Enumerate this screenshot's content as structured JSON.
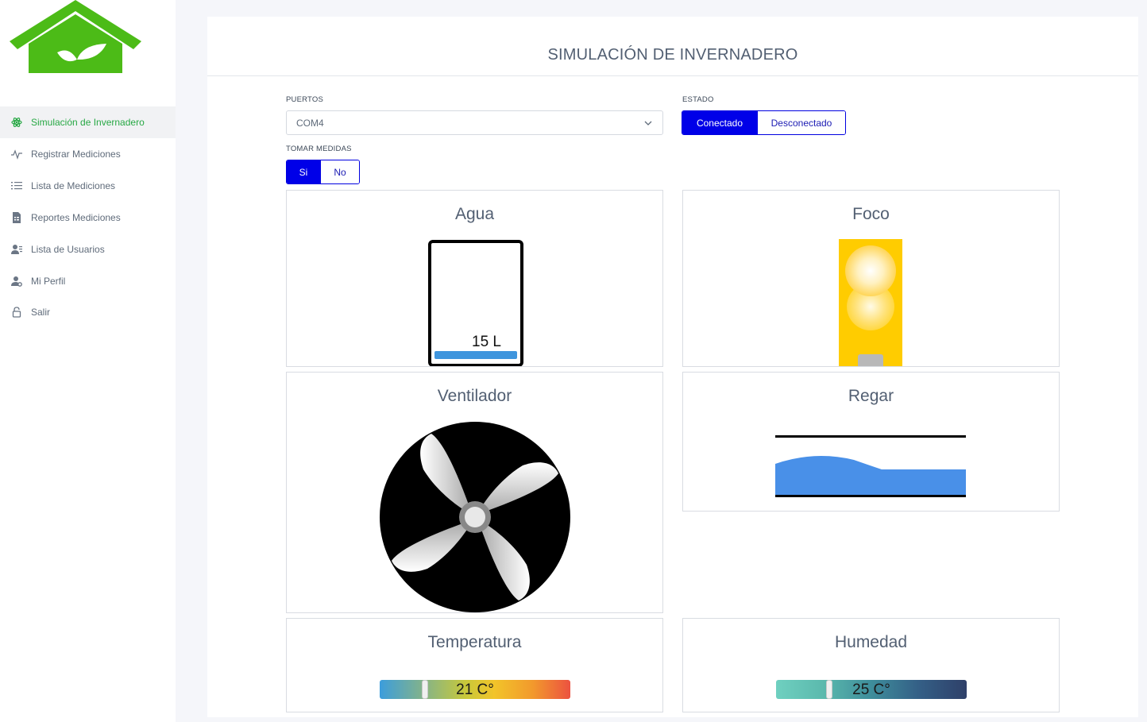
{
  "sidebar": {
    "items": [
      {
        "label": "Simulación de Invernadero",
        "icon": "atom-icon",
        "active": true
      },
      {
        "label": "Registrar Mediciones",
        "icon": "pulse-icon"
      },
      {
        "label": "Lista de Mediciones",
        "icon": "list-icon"
      },
      {
        "label": "Reportes Mediciones",
        "icon": "report-icon"
      },
      {
        "label": "Lista de Usuarios",
        "icon": "users-icon"
      },
      {
        "label": "Mi Perfil",
        "icon": "user-gear-icon"
      },
      {
        "label": "Salir",
        "icon": "lock-icon"
      }
    ]
  },
  "main": {
    "title": "SIMULACIÓN DE INVERNADERO",
    "puertos": {
      "label": "PUERTOS",
      "value": "COM4"
    },
    "estado": {
      "label": "ESTADO",
      "options": [
        "Conectado",
        "Desconectado"
      ],
      "selected": "Conectado"
    },
    "tomar_medidas": {
      "label": "TOMAR MEDIDAS",
      "options": [
        "Si",
        "No"
      ],
      "selected": "Si"
    }
  },
  "panels": {
    "agua": {
      "title": "Agua",
      "value_text": "15 L"
    },
    "foco": {
      "title": "Foco"
    },
    "ventilador": {
      "title": "Ventilador"
    },
    "regar": {
      "title": "Regar"
    },
    "temperatura": {
      "title": "Temperatura",
      "value_text": "21 C°",
      "level": 0.23
    },
    "humedad": {
      "title": "Humedad",
      "value_text": "25 C°",
      "level": 0.27
    }
  },
  "colors": {
    "brand_green": "#4cbb17",
    "active_nav": "#27a844",
    "primary_blue": "#0000e8",
    "water_blue": "#3f95dd",
    "bulb_yellow": "#ffcc00"
  }
}
